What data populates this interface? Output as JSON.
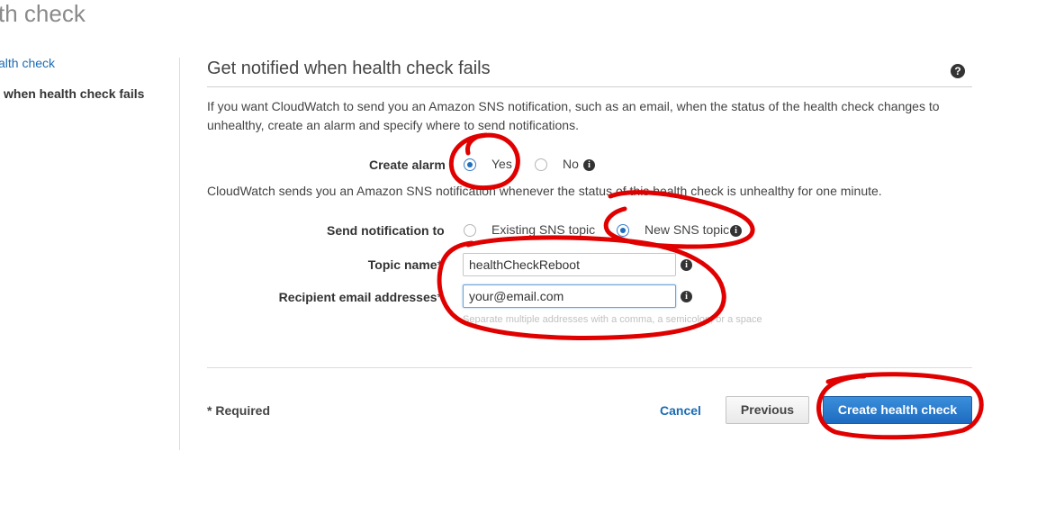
{
  "header": {
    "title": "th check"
  },
  "sidebar": {
    "items": [
      {
        "label": "alth check"
      },
      {
        "label": "when health check fails"
      }
    ]
  },
  "section": {
    "title": "Get notified when health check fails",
    "intro": "If you want CloudWatch to send you an Amazon SNS notification, such as an email, when the status of the health check changes to unhealthy, create an alarm and specify where to send notifications."
  },
  "form": {
    "create_alarm": {
      "label": "Create alarm",
      "options": [
        "Yes",
        "No"
      ],
      "selected": "Yes"
    },
    "alarm_note": "CloudWatch sends you an Amazon SNS notification whenever the status of this health check is unhealthy for one minute.",
    "send_notification": {
      "label": "Send notification to",
      "options": [
        "Existing SNS topic",
        "New SNS topic"
      ],
      "selected": "New SNS topic"
    },
    "topic_name": {
      "label": "Topic name",
      "required_mark": "*",
      "value": "healthCheckReboot"
    },
    "recipient_emails": {
      "label": "Recipient email addresses",
      "required_mark": "*",
      "value": "your@email.com",
      "hint": "Separate multiple addresses with a comma, a semicolon, or a space"
    }
  },
  "footer": {
    "required_note": "* Required",
    "cancel_label": "Cancel",
    "previous_label": "Previous",
    "create_label": "Create health check"
  },
  "icons": {
    "help": "help-icon",
    "info": "info-icon"
  },
  "colors": {
    "link": "#1a6bb3",
    "primary_button": "#1d6bc1",
    "annotation": "#e00000"
  }
}
